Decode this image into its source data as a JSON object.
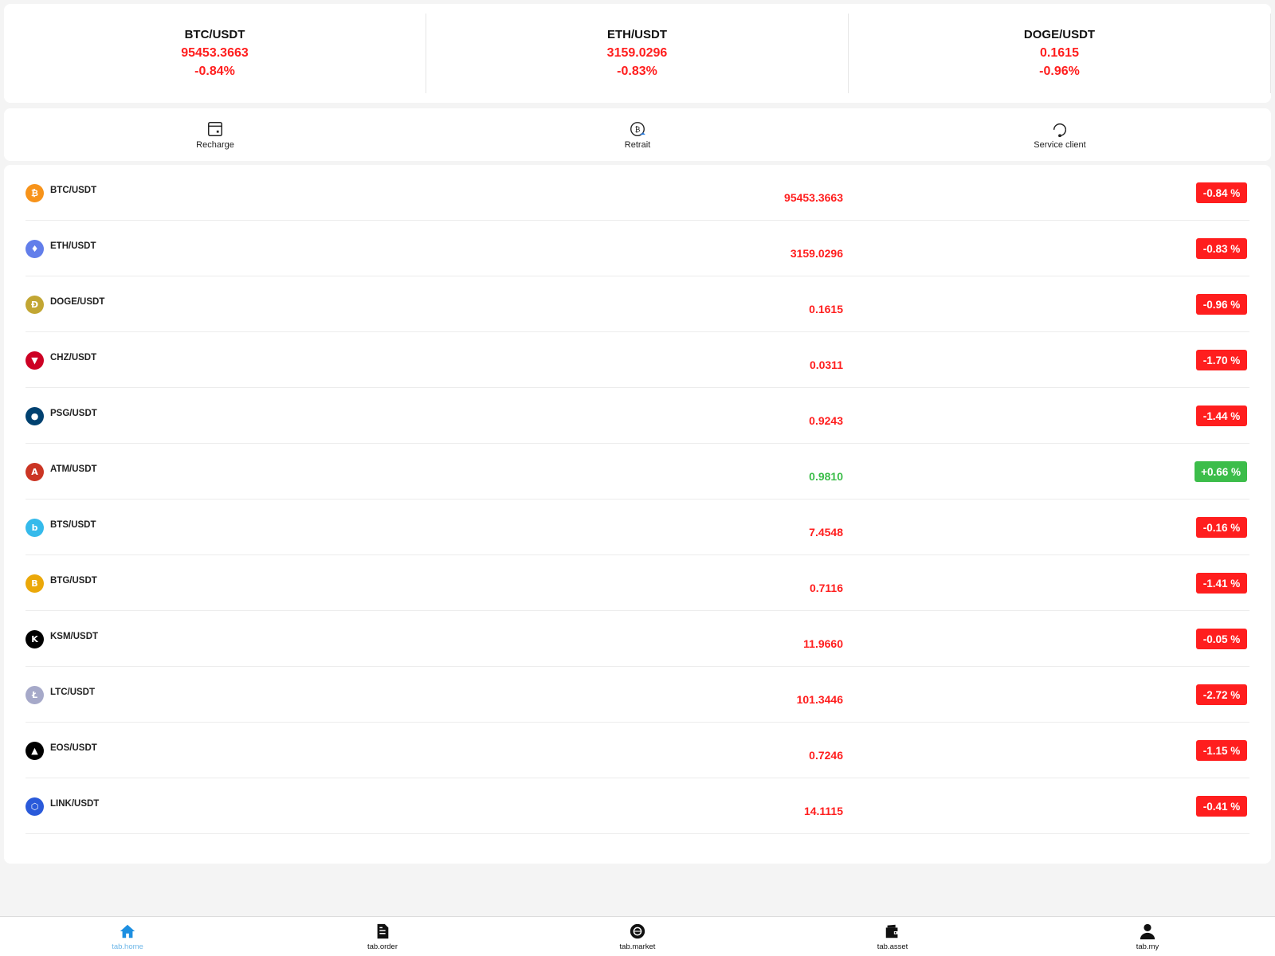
{
  "tickers": [
    {
      "pair": "BTC/USDT",
      "price": "95453.3663",
      "change": "-0.84%"
    },
    {
      "pair": "ETH/USDT",
      "price": "3159.0296",
      "change": "-0.83%"
    },
    {
      "pair": "DOGE/USDT",
      "price": "0.1615",
      "change": "-0.96%"
    }
  ],
  "actions": {
    "recharge": "Recharge",
    "withdraw": "Retrait",
    "service": "Service client"
  },
  "markets": [
    {
      "pair": "BTC/USDT",
      "price": "95453.3663",
      "change": "-0.84 %",
      "icon": "btc-icon",
      "color": "#f7931a",
      "glyph": "₿"
    },
    {
      "pair": "ETH/USDT",
      "price": "3159.0296",
      "change": "-0.83 %",
      "icon": "eth-icon",
      "color": "#627eea",
      "glyph": "♦"
    },
    {
      "pair": "DOGE/USDT",
      "price": "0.1615",
      "change": "-0.96 %",
      "icon": "doge-icon",
      "color": "#c2a633",
      "glyph": "Ð"
    },
    {
      "pair": "CHZ/USDT",
      "price": "0.0311",
      "change": "-1.70 %",
      "icon": "chz-icon",
      "color": "#cd0124",
      "glyph": "▼"
    },
    {
      "pair": "PSG/USDT",
      "price": "0.9243",
      "change": "-1.44 %",
      "icon": "psg-icon",
      "color": "#004170",
      "glyph": "●"
    },
    {
      "pair": "ATM/USDT",
      "price": "0.9810",
      "change": "+0.66 %",
      "icon": "atm-icon",
      "color": "#cb3524",
      "glyph": "A"
    },
    {
      "pair": "BTS/USDT",
      "price": "7.4548",
      "change": "-0.16 %",
      "icon": "bts-icon",
      "color": "#35baeb",
      "glyph": "b"
    },
    {
      "pair": "BTG/USDT",
      "price": "0.7116",
      "change": "-1.41 %",
      "icon": "btg-icon",
      "color": "#eba809",
      "glyph": "B"
    },
    {
      "pair": "KSM/USDT",
      "price": "11.9660",
      "change": "-0.05 %",
      "icon": "ksm-icon",
      "color": "#000000",
      "glyph": "K"
    },
    {
      "pair": "LTC/USDT",
      "price": "101.3446",
      "change": "-2.72 %",
      "icon": "ltc-icon",
      "color": "#a6a9c9",
      "glyph": "Ł"
    },
    {
      "pair": "EOS/USDT",
      "price": "0.7246",
      "change": "-1.15 %",
      "icon": "eos-icon",
      "color": "#000000",
      "glyph": "▲"
    },
    {
      "pair": "LINK/USDT",
      "price": "14.1115",
      "change": "-0.41 %",
      "icon": "link-icon",
      "color": "#2a5ada",
      "glyph": "⬡"
    }
  ],
  "tabs": [
    {
      "label": "tab.home",
      "icon": "home-icon"
    },
    {
      "label": "tab.order",
      "icon": "document-icon"
    },
    {
      "label": "tab.market",
      "icon": "market-icon"
    },
    {
      "label": "tab.asset",
      "icon": "wallet-icon"
    },
    {
      "label": "tab.my",
      "icon": "user-icon"
    }
  ],
  "colors": {
    "down": "#ff1e1e",
    "up": "#3cbd4a",
    "active_tab": "#6fb7e8"
  }
}
